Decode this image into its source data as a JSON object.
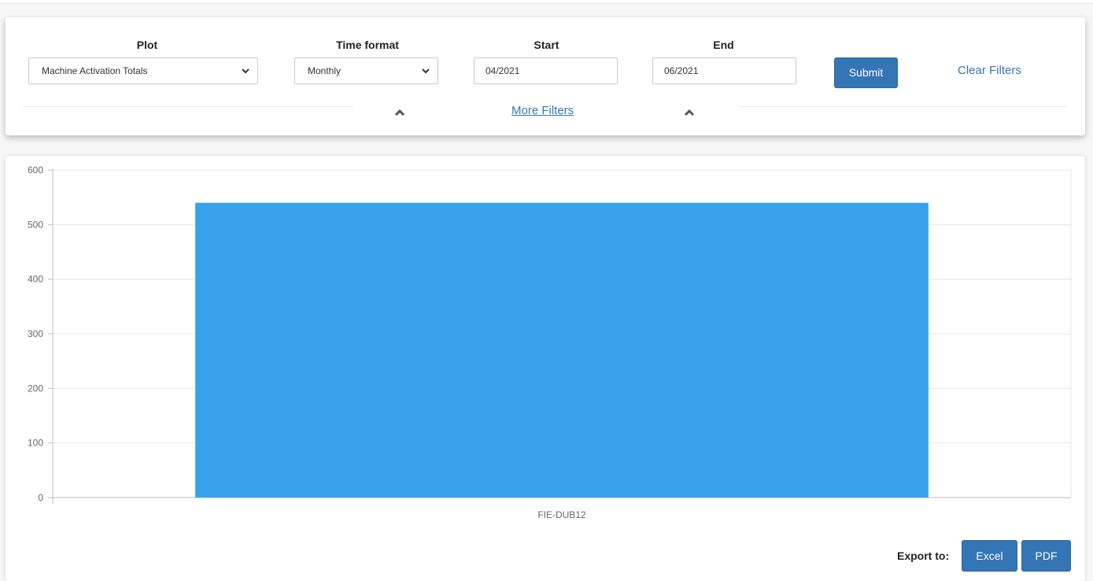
{
  "filters": {
    "plot": {
      "label": "Plot",
      "value": "Machine Activation Totals"
    },
    "time_format": {
      "label": "Time format",
      "value": "Monthly"
    },
    "start": {
      "label": "Start",
      "value": "04/2021"
    },
    "end": {
      "label": "End",
      "value": "06/2021"
    },
    "submit_label": "Submit",
    "clear_label": "Clear Filters",
    "more_filters_label": "More Filters"
  },
  "export": {
    "label": "Export to:",
    "excel_label": "Excel",
    "pdf_label": "PDF"
  },
  "colors": {
    "accent": "#3475b5",
    "bar": "#37a2eb"
  },
  "chart_data": {
    "type": "bar",
    "categories": [
      "FIE-DUB12"
    ],
    "values": [
      540
    ],
    "title": "",
    "xlabel": "",
    "ylabel": "",
    "ylim": [
      0,
      600
    ],
    "yticks": [
      0,
      100,
      200,
      300,
      400,
      500,
      600
    ],
    "grid": true
  }
}
